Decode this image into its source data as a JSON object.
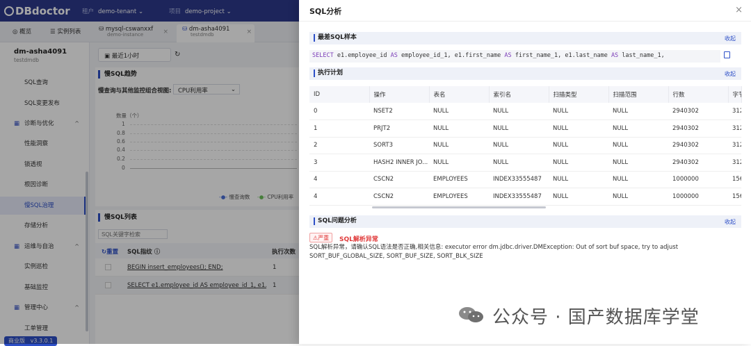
{
  "app": {
    "logo": "DBdoctor",
    "tenant_key": "租户",
    "tenant_value": "demo-tenant",
    "project_key": "项目",
    "project_value": "demo-project",
    "version_label": "商业版",
    "version": "v3.3.0.1"
  },
  "tabs": [
    {
      "label": "概览"
    },
    {
      "label": "实例列表"
    },
    {
      "label": "mysql-cswanxxf",
      "sub": "demo-instance"
    },
    {
      "label": "dm-asha4091",
      "sub": "testdmdb"
    }
  ],
  "sidebar": {
    "instance_name": "dm-asha4091",
    "instance_db": "testdmdb",
    "items": [
      {
        "label": "SQL查询"
      },
      {
        "label": "SQL变更发布"
      },
      {
        "label": "诊断与优化"
      },
      {
        "label": "性能洞察"
      },
      {
        "label": "锁透视"
      },
      {
        "label": "根因诊断"
      },
      {
        "label": "慢SQL治理"
      },
      {
        "label": "存储分析"
      },
      {
        "label": "运维与自治"
      },
      {
        "label": "实例巡检"
      },
      {
        "label": "基础监控"
      },
      {
        "label": "管理中心"
      },
      {
        "label": "工单管理"
      }
    ]
  },
  "main": {
    "time_range": "最近1小时",
    "trend_title": "慢SQL趋势",
    "combine_label": "慢查询与其他监控组合视图:",
    "combine_value": "CPU利用率",
    "y_axis_label": "数量（个）",
    "y_ticks": [
      "1",
      "0.8",
      "0.6",
      "0.4",
      "0.2",
      "0"
    ],
    "legend": [
      "慢查询数",
      "CPU利用率"
    ],
    "list_title": "慢SQL列表",
    "search_placeholder": "SQL关键字检索",
    "reset_label": "重置",
    "col_sql": "SQL指纹",
    "col_exec": "执行次数",
    "rows": [
      {
        "sql": "BEGIN insert_employees(); END;",
        "count": "1"
      },
      {
        "sql": "SELECT e1.employee_id AS employee_id_1, e1.fir...",
        "count": "1"
      }
    ]
  },
  "drawer": {
    "title": "SQL分析",
    "sample_title": "最差SQL样本",
    "collapse": "收起",
    "sql_sample": "SELECT e1.employee_id AS employee_id_1, e1.first_name AS first_name_1, e1.last_name AS last_name_1,",
    "plan_title": "执行计划",
    "plan_columns": [
      "ID",
      "操作",
      "表名",
      "索引名",
      "扫描类型",
      "扫描范围",
      "行数",
      "字节"
    ],
    "plan_rows": [
      [
        "0",
        "NSET2",
        "NULL",
        "NULL",
        "NULL",
        "NULL",
        "2940302",
        "312"
      ],
      [
        "1",
        "PRJT2",
        "NULL",
        "NULL",
        "NULL",
        "NULL",
        "2940302",
        "312"
      ],
      [
        "2",
        "SORT3",
        "NULL",
        "NULL",
        "NULL",
        "NULL",
        "2940302",
        "312"
      ],
      [
        "3",
        "HASH2 INNER JO...",
        "NULL",
        "NULL",
        "NULL",
        "NULL",
        "2940302",
        "312"
      ],
      [
        "4",
        "CSCN2",
        "EMPLOYEES",
        "INDEX33555487",
        "NULL",
        "NULL",
        "1000000",
        "156"
      ],
      [
        "4",
        "CSCN2",
        "EMPLOYEES",
        "INDEX33555487",
        "NULL",
        "NULL",
        "1000000",
        "156"
      ]
    ],
    "problem_title": "SQL问题分析",
    "severity": "严重",
    "error_title": "SQL解析异常",
    "error_text": "SQL解析异常，请确认SQL语法是否正确,相关信息: executor error dm.jdbc.driver.DMException: Out of sort buf space, try to adjust SORT_BUF_GLOBAL_SIZE, SORT_BUF_SIZE, SORT_BLK_SIZE"
  },
  "watermark": "公众号 · 国产数据库学堂"
}
